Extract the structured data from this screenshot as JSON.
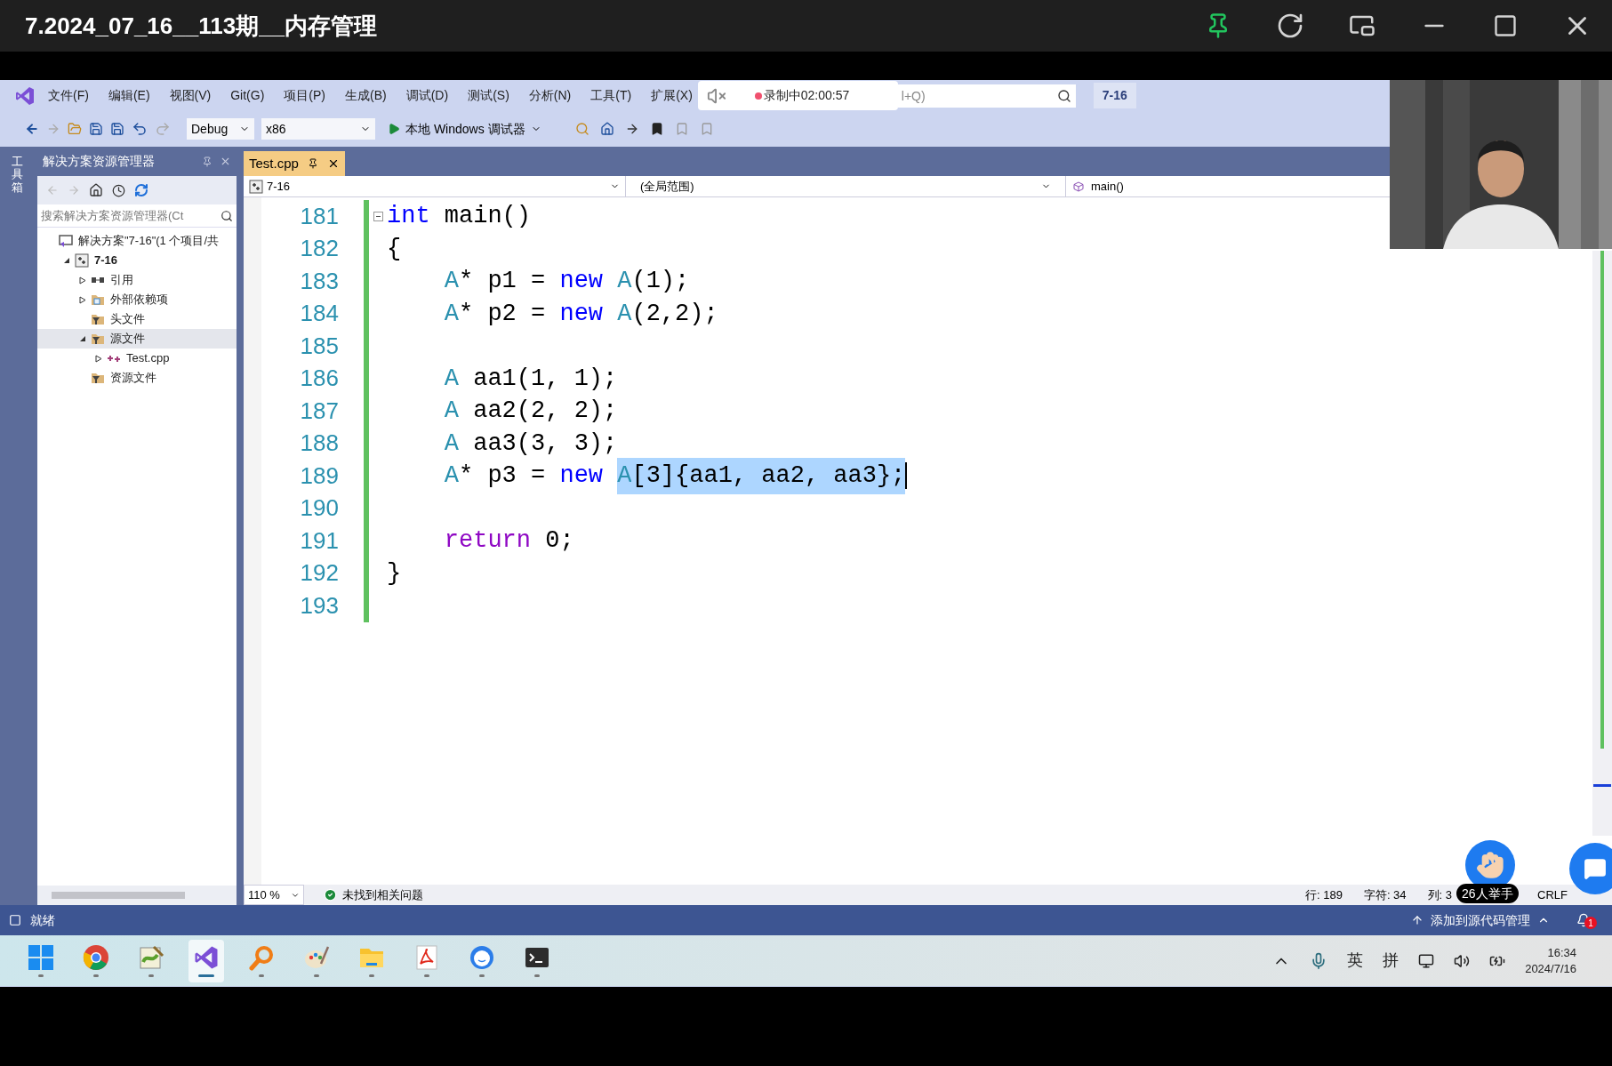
{
  "title_bar": {
    "title": "7.2024_07_16__113期__内存管理"
  },
  "menu": [
    "文件(F)",
    "编辑(E)",
    "视图(V)",
    "Git(G)",
    "项目(P)",
    "生成(B)",
    "调试(D)",
    "测试(S)",
    "分析(N)",
    "工具(T)",
    "扩展(X)"
  ],
  "recording": {
    "text": "录制中02:00:57"
  },
  "search": {
    "placeholder": "l+Q)"
  },
  "project_badge": "7-16",
  "toolbar": {
    "configuration": "Debug",
    "platform": "x86",
    "run_label": "本地 Windows 调试器"
  },
  "toolbox_label": "工具箱",
  "solution_explorer": {
    "title": "解决方案资源管理器",
    "search_placeholder": "搜索解决方案资源管理器(Ct",
    "tree": [
      {
        "label": "解决方案\"7-16\"(1 个项目/共",
        "kind": "solution",
        "selected": false,
        "children": [
          {
            "label": "7-16",
            "kind": "project",
            "expanded": true,
            "selected": false,
            "children": [
              {
                "label": "引用",
                "kind": "references",
                "expanded": false,
                "selected": false
              },
              {
                "label": "外部依赖项",
                "kind": "external",
                "expanded": false,
                "selected": false
              },
              {
                "label": "头文件",
                "kind": "filter",
                "selected": false
              },
              {
                "label": "源文件",
                "kind": "filter",
                "expanded": true,
                "selected": true,
                "children": [
                  {
                    "label": "Test.cpp",
                    "kind": "cpp",
                    "expanded": false,
                    "selected": false
                  }
                ]
              },
              {
                "label": "资源文件",
                "kind": "filter",
                "selected": false
              }
            ]
          }
        ]
      }
    ]
  },
  "editor": {
    "tab": {
      "label": "Test.cpp",
      "selected": true
    },
    "nav": [
      "7-16",
      "(全局范围)",
      "main()"
    ],
    "lines": [
      {
        "number": "181",
        "collapsible": true,
        "tokens": [
          {
            "kind": "keyword",
            "text": "int"
          },
          {
            "kind": "plain",
            "text": " main()"
          }
        ]
      },
      {
        "number": "182",
        "tokens": [
          {
            "kind": "plain",
            "text": "{"
          }
        ]
      },
      {
        "number": "183",
        "tokens": [
          {
            "kind": "type",
            "text": "    A"
          },
          {
            "kind": "plain",
            "text": "* p1 = "
          },
          {
            "kind": "keyword",
            "text": "new "
          },
          {
            "kind": "type",
            "text": "A"
          },
          {
            "kind": "plain",
            "text": "(1);"
          }
        ]
      },
      {
        "number": "184",
        "tokens": [
          {
            "kind": "type",
            "text": "    A"
          },
          {
            "kind": "plain",
            "text": "* p2 = "
          },
          {
            "kind": "keyword",
            "text": "new "
          },
          {
            "kind": "type",
            "text": "A"
          },
          {
            "kind": "plain",
            "text": "(2,2);"
          }
        ]
      },
      {
        "number": "185"
      },
      {
        "number": "186",
        "tokens": [
          {
            "kind": "type",
            "text": "    A"
          },
          {
            "kind": "plain",
            "text": " aa1(1, 1);"
          }
        ]
      },
      {
        "number": "187",
        "tokens": [
          {
            "kind": "type",
            "text": "    A"
          },
          {
            "kind": "plain",
            "text": " aa2(2, 2);"
          }
        ]
      },
      {
        "number": "188",
        "tokens": [
          {
            "kind": "type",
            "text": "    A"
          },
          {
            "kind": "plain",
            "text": " aa3(3, 3);"
          }
        ]
      },
      {
        "number": "189",
        "caret": true,
        "tokens": [
          {
            "kind": "type",
            "text": "    A",
            "selected": false
          },
          {
            "kind": "plain",
            "text": "* p3 = ",
            "selected": false
          },
          {
            "kind": "keyword",
            "text": "new ",
            "selected": false
          },
          {
            "kind": "type",
            "text": "A",
            "selected": true
          },
          {
            "kind": "plain",
            "text": "[3]{aa1, aa2, aa3};",
            "selected": true
          }
        ]
      },
      {
        "number": "190"
      },
      {
        "number": "191",
        "tokens": [
          {
            "kind": "control",
            "text": "    return"
          },
          {
            "kind": "plain",
            "text": " 0;"
          }
        ]
      },
      {
        "number": "192",
        "tokens": [
          {
            "kind": "plain",
            "text": "}"
          }
        ]
      },
      {
        "number": "193"
      }
    ]
  },
  "editor_status": {
    "zoom": "110 %",
    "issues": "未找到相关问题",
    "line": "行: 189",
    "char": "字符: 34",
    "col": "列: 3",
    "eol": "CRLF"
  },
  "raise_hand": {
    "label": "26人举手"
  },
  "status_bar": {
    "text": "就绪",
    "source_control": "添加到源代码管理",
    "notifications": "1"
  },
  "taskbar": {
    "apps": [
      {
        "kind": "start",
        "selected": false
      },
      {
        "kind": "browser",
        "selected": false
      },
      {
        "kind": "notepad",
        "selected": false
      },
      {
        "kind": "vs",
        "selected": true
      },
      {
        "kind": "search",
        "selected": false
      },
      {
        "kind": "paint",
        "selected": false
      },
      {
        "kind": "folder",
        "selected": false
      },
      {
        "kind": "pdf",
        "selected": false
      },
      {
        "kind": "chat",
        "selected": false
      },
      {
        "kind": "terminal",
        "selected": false
      }
    ],
    "ime_lang": "英",
    "ime_mode": "拼",
    "time": "16:34",
    "date": "2024/7/16"
  }
}
